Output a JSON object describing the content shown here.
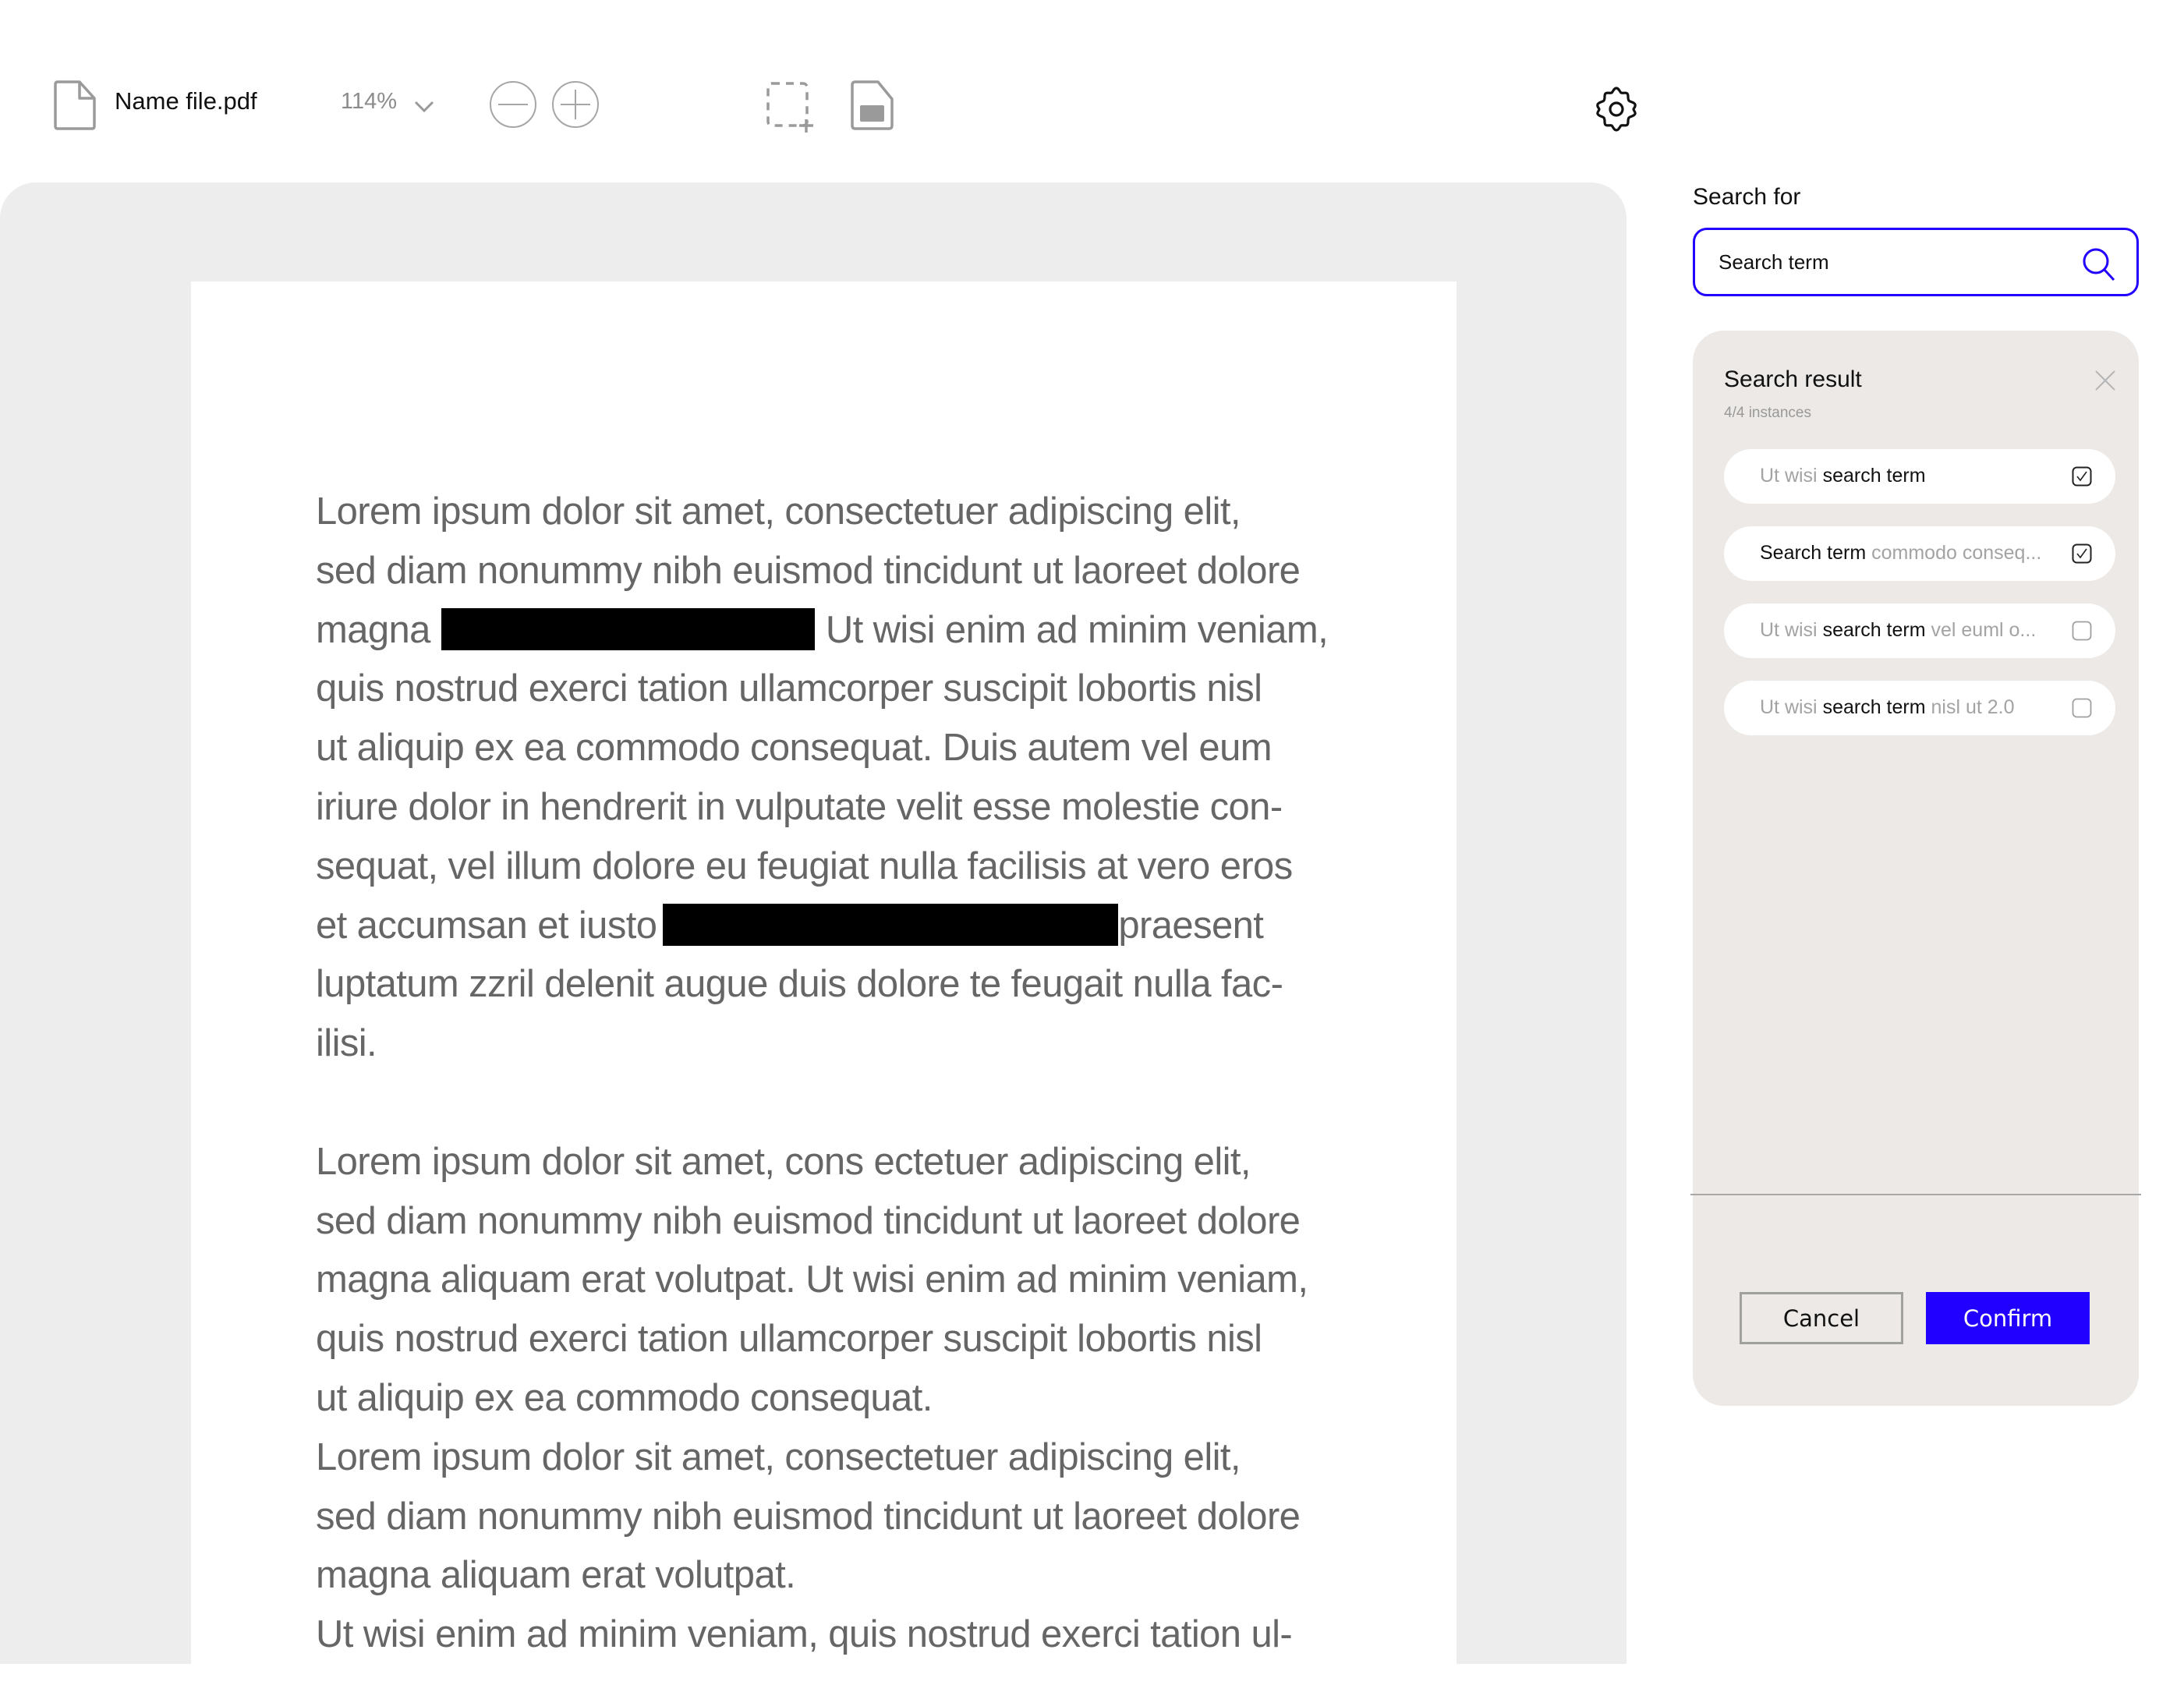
{
  "toolbar": {
    "file_name": "Name file.pdf",
    "zoom_level": "114%",
    "icons": {
      "file": "file-icon",
      "zoom_dropdown": "chevron-down-icon",
      "zoom_out": "zoom-out-icon",
      "zoom_in": "zoom-in-icon",
      "area_select": "area-select-icon",
      "save": "save-icon",
      "settings": "gear-icon"
    }
  },
  "document": {
    "paragraphs": [
      {
        "lines": [
          [
            "Lorem ipsum dolor sit amet, consectetuer adipiscing elit,"
          ],
          [
            "sed diam nonummy nibh euismod tincidunt ut laoreet dolore"
          ],
          [
            "magna",
            "[REDACTED]",
            "Ut wisi enim ad minim veniam,"
          ],
          [
            "quis nostrud exerci tation ullamcorper suscipit lobortis nisl"
          ],
          [
            "ut aliquip ex ea commodo consequat. Duis autem vel eum"
          ],
          [
            "iriure dolor in hendrerit in vulputate velit esse molestie con-"
          ],
          [
            "sequat, vel illum dolore eu feugiat nulla facilisis at vero eros"
          ],
          [
            "et accumsan et iusto",
            "[REDACTED]",
            "praesent"
          ],
          [
            "luptatum zzril delenit augue duis dolore te feugait nulla fac-"
          ],
          [
            "ilisi."
          ]
        ]
      },
      {
        "lines": [
          [
            "Lorem ipsum dolor sit amet, cons ectetuer adipiscing elit,"
          ],
          [
            "sed diam nonummy nibh euismod tincidunt ut laoreet dolore"
          ],
          [
            "magna aliquam erat volutpat. Ut wisi enim ad minim veniam,"
          ],
          [
            "quis nostrud exerci tation ullamcorper suscipit lobortis nisl"
          ],
          [
            "ut aliquip ex ea commodo consequat."
          ],
          [
            "Lorem ipsum dolor sit amet, consectetuer adipiscing elit,"
          ],
          [
            "sed diam nonummy nibh euismod tincidunt ut laoreet dolore"
          ],
          [
            "magna aliquam erat volutpat."
          ],
          [
            "Ut wisi enim ad minim veniam, quis nostrud exerci tation ul-"
          ]
        ]
      }
    ],
    "redaction_color": "#000000"
  },
  "search": {
    "label": "Search for",
    "input_value": "Search term",
    "input_placeholder": "Search term",
    "accent_color": "#2200ff"
  },
  "results": {
    "title": "Search result",
    "count": "4/4 instances",
    "items": [
      {
        "pre": "Ut wisi ",
        "match": "search term",
        "post": "",
        "checked": true
      },
      {
        "pre": "",
        "match": "Search term",
        "post": " commodo conseq...",
        "checked": true
      },
      {
        "pre": "Ut wisi ",
        "match": "search term",
        "post": " vel euml o...",
        "checked": false
      },
      {
        "pre": "Ut wisi ",
        "match": "search term",
        "post": " nisl ut 2.0",
        "checked": false
      }
    ]
  },
  "actions": {
    "cancel_label": "Cancel",
    "confirm_label": "Confirm",
    "confirm_color": "#2200ff"
  }
}
